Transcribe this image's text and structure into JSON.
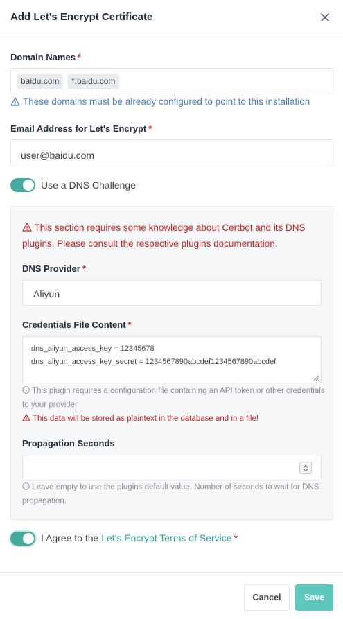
{
  "modal": {
    "title": "Add Let's Encrypt Certificate",
    "close_icon": "close-icon"
  },
  "domain_names": {
    "label": "Domain Names",
    "required_mark": "*",
    "tags": [
      "baidu.com",
      "*.baidu.com"
    ],
    "hint_icon": "warning-triangle-icon",
    "hint": "These domains must be already configured to point to this installation"
  },
  "email": {
    "label": "Email Address for Let's Encrypt",
    "required_mark": "*",
    "value": "user@baidu.com"
  },
  "dns_challenge": {
    "label": "Use a DNS Challenge",
    "enabled": true
  },
  "dns_section": {
    "warning_icon": "warning-triangle-icon",
    "warning": "This section requires some knowledge about Certbot and its DNS plugins. Please consult the respective plugins documentation.",
    "provider": {
      "label": "DNS Provider",
      "required_mark": "*",
      "value": "Aliyun"
    },
    "credentials": {
      "label": "Credentials File Content",
      "required_mark": "*",
      "lines": [
        "dns_aliyun_access_key = 12345678",
        "dns_aliyun_access_key_secret = 1234567890abcdef1234567890abcdef"
      ],
      "info_icon": "info-circle-icon",
      "info": "This plugin requires a configuration file containing an API token or other credentials to your provider",
      "danger_icon": "warning-triangle-icon",
      "danger": "This data will be stored as plaintext in the database and in a file!"
    },
    "propagation": {
      "label": "Propagation Seconds",
      "value": "",
      "info_icon": "info-circle-icon",
      "info": "Leave empty to use the plugins default value. Number of seconds to wait for DNS propagation."
    }
  },
  "agree": {
    "prefix": "I Agree to the",
    "link": "Let's Encrypt Terms of Service",
    "required_mark": "*",
    "enabled": true
  },
  "footer": {
    "cancel": "Cancel",
    "save": "Save"
  },
  "colors": {
    "accent": "#45aaa0",
    "save_button": "#5ec8bd",
    "danger": "#cd201f",
    "info": "#467fcf",
    "link": "#2aa1a0"
  }
}
